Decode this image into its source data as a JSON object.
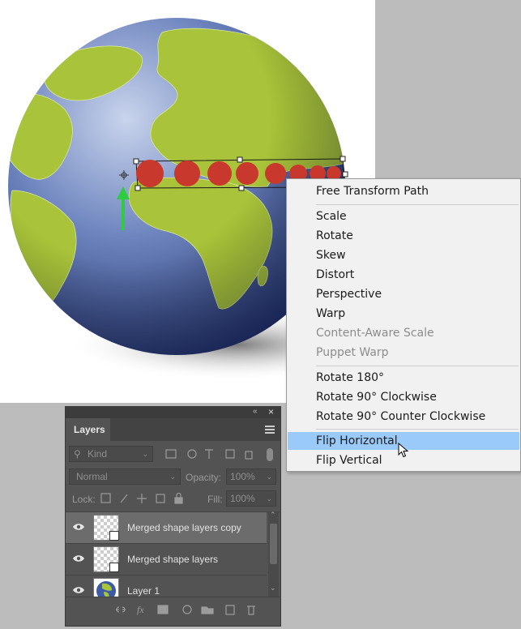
{
  "context_menu": {
    "items": [
      {
        "label": "Free Transform Path",
        "enabled": true
      },
      {
        "label": "Scale",
        "enabled": true
      },
      {
        "label": "Rotate",
        "enabled": true
      },
      {
        "label": "Skew",
        "enabled": true
      },
      {
        "label": "Distort",
        "enabled": true
      },
      {
        "label": "Perspective",
        "enabled": true
      },
      {
        "label": "Warp",
        "enabled": true
      },
      {
        "label": "Content-Aware Scale",
        "enabled": false
      },
      {
        "label": "Puppet Warp",
        "enabled": false
      },
      {
        "label": "Rotate 180°",
        "enabled": true
      },
      {
        "label": "Rotate 90° Clockwise",
        "enabled": true
      },
      {
        "label": "Rotate 90° Counter Clockwise",
        "enabled": true
      },
      {
        "label": "Flip Horizontal",
        "enabled": true,
        "highlighted": true
      },
      {
        "label": "Flip Vertical",
        "enabled": true
      }
    ]
  },
  "layers_panel": {
    "tab_label": "Layers",
    "filter_kind": "Kind",
    "blend_mode": "Normal",
    "opacity_label": "Opacity:",
    "opacity_value": "100%",
    "lock_label": "Lock:",
    "fill_label": "Fill:",
    "fill_value": "100%",
    "layers": [
      {
        "name": "Merged shape layers copy",
        "selected": true,
        "visible": true
      },
      {
        "name": "Merged shape layers",
        "selected": false,
        "visible": true
      },
      {
        "name": "Layer 1",
        "selected": false,
        "visible": true
      }
    ],
    "bottom_icons": [
      "link-icon",
      "fx-icon",
      "mask-icon",
      "adjustment-icon",
      "folder-icon",
      "new-layer-icon",
      "trash-icon"
    ]
  },
  "colors": {
    "menu_highlight": "#99caf9",
    "arrow": "#2ecc40",
    "dots": "#c8382c"
  }
}
